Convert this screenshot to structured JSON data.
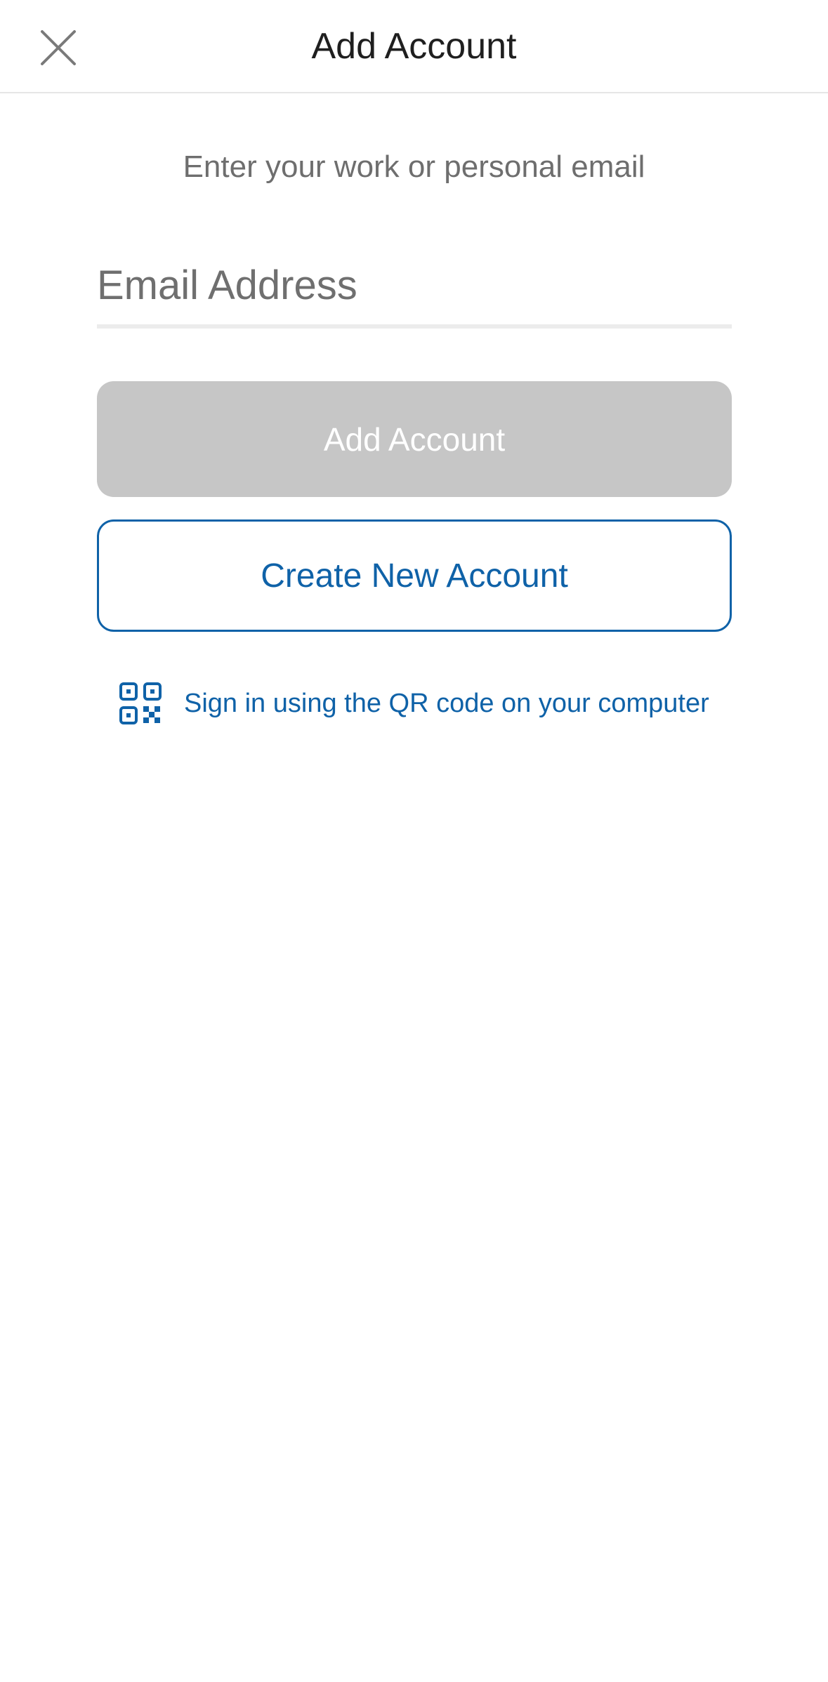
{
  "nav": {
    "title": "Add Account",
    "close_icon": "close-icon"
  },
  "prompt": {
    "subtitle": "Enter your work or personal email"
  },
  "email": {
    "placeholder": "Email Address",
    "value": ""
  },
  "buttons": {
    "add_account_label": "Add Account",
    "create_account_label": "Create New Account"
  },
  "qr": {
    "icon": "qr-code-icon",
    "label": "Sign in using the QR code on your computer"
  },
  "colors": {
    "accent": "#0f62a8",
    "disabled_button": "#c6c6c6",
    "title_text": "#1f1f1f",
    "secondary_text": "#6e6e6e"
  }
}
